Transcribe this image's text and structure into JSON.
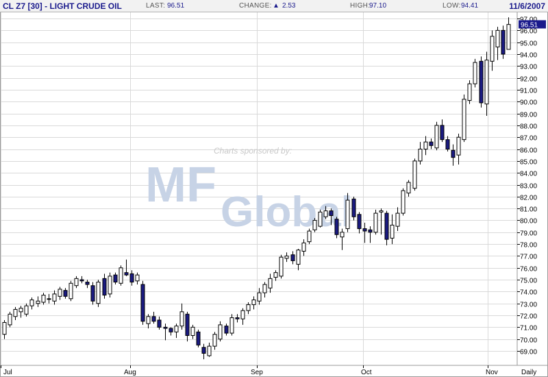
{
  "header": {
    "title": "CL Z7 [30] - LIGHT CRUDE OIL",
    "last_label": "LAST:",
    "last_value": "96.51",
    "change_label": "CHANGE:",
    "change_value": "2.53",
    "high_label": "HIGH:",
    "high_value": "97.10",
    "low_label": "LOW:",
    "low_value": "94.41",
    "date": "11/6/2007"
  },
  "watermark": {
    "sponsor_text": "Charts sponsored by:",
    "logo_text": "MF",
    "logo_word": "Global"
  },
  "period_label": "Daily",
  "last_price_tag": "96.51",
  "colors": {
    "up_fill": "#ffffff",
    "down_fill": "#1a1a80",
    "candle_stroke": "#000000",
    "grid": "#d9d9d9",
    "change_arrow": "#1a1a8c",
    "price_tag_bg": "#1a1a8c"
  },
  "chart_data": {
    "type": "candlestick",
    "y_range": [
      68,
      97
    ],
    "y_ticks": [
      "69.00",
      "70.00",
      "71.00",
      "72.00",
      "73.00",
      "74.00",
      "75.00",
      "76.00",
      "77.00",
      "78.00",
      "79.00",
      "80.00",
      "81.00",
      "82.00",
      "83.00",
      "84.00",
      "85.00",
      "86.00",
      "87.00",
      "88.00",
      "89.00",
      "90.00",
      "91.00",
      "92.00",
      "93.00",
      "94.00",
      "95.00",
      "96.00",
      "97.00"
    ],
    "x_labels": [
      "Jul",
      "Aug",
      "Sep",
      "Oct",
      "Nov"
    ],
    "candles": [
      {
        "o": 70.4,
        "h": 71.6,
        "l": 70.0,
        "c": 71.4
      },
      {
        "o": 71.2,
        "h": 72.3,
        "l": 71.0,
        "c": 72.1
      },
      {
        "o": 71.9,
        "h": 72.7,
        "l": 71.6,
        "c": 72.5
      },
      {
        "o": 72.3,
        "h": 72.8,
        "l": 71.8,
        "c": 72.6
      },
      {
        "o": 72.1,
        "h": 73.0,
        "l": 71.9,
        "c": 72.8
      },
      {
        "o": 72.8,
        "h": 73.5,
        "l": 72.5,
        "c": 73.3
      },
      {
        "o": 73.0,
        "h": 73.6,
        "l": 72.7,
        "c": 73.2
      },
      {
        "o": 73.1,
        "h": 73.9,
        "l": 72.9,
        "c": 73.7
      },
      {
        "o": 73.4,
        "h": 73.8,
        "l": 73.0,
        "c": 73.4
      },
      {
        "o": 73.2,
        "h": 74.1,
        "l": 72.9,
        "c": 73.8
      },
      {
        "o": 73.6,
        "h": 74.4,
        "l": 73.3,
        "c": 74.2
      },
      {
        "o": 74.1,
        "h": 74.3,
        "l": 73.4,
        "c": 73.6
      },
      {
        "o": 73.4,
        "h": 74.9,
        "l": 73.2,
        "c": 74.7
      },
      {
        "o": 74.5,
        "h": 75.3,
        "l": 74.3,
        "c": 75.1
      },
      {
        "o": 75.0,
        "h": 75.3,
        "l": 74.7,
        "c": 74.9
      },
      {
        "o": 74.8,
        "h": 75.0,
        "l": 74.3,
        "c": 74.6
      },
      {
        "o": 74.5,
        "h": 74.8,
        "l": 72.9,
        "c": 73.2
      },
      {
        "o": 73.0,
        "h": 75.0,
        "l": 72.7,
        "c": 74.8
      },
      {
        "o": 75.1,
        "h": 75.5,
        "l": 73.4,
        "c": 73.7
      },
      {
        "o": 73.8,
        "h": 75.6,
        "l": 73.5,
        "c": 75.3
      },
      {
        "o": 75.4,
        "h": 75.6,
        "l": 74.6,
        "c": 74.8
      },
      {
        "o": 74.7,
        "h": 76.2,
        "l": 74.5,
        "c": 76.0
      },
      {
        "o": 75.6,
        "h": 76.7,
        "l": 75.3,
        "c": 75.4
      },
      {
        "o": 75.5,
        "h": 75.8,
        "l": 74.5,
        "c": 74.8
      },
      {
        "o": 74.9,
        "h": 75.6,
        "l": 74.6,
        "c": 75.4
      },
      {
        "o": 74.6,
        "h": 74.9,
        "l": 71.2,
        "c": 71.5
      },
      {
        "o": 71.3,
        "h": 72.1,
        "l": 70.9,
        "c": 71.9
      },
      {
        "o": 71.9,
        "h": 72.3,
        "l": 71.3,
        "c": 71.5
      },
      {
        "o": 71.6,
        "h": 71.9,
        "l": 70.8,
        "c": 71.0
      },
      {
        "o": 71.0,
        "h": 71.3,
        "l": 69.9,
        "c": 70.9
      },
      {
        "o": 70.9,
        "h": 71.0,
        "l": 70.3,
        "c": 70.6
      },
      {
        "o": 70.6,
        "h": 71.3,
        "l": 70.1,
        "c": 71.1
      },
      {
        "o": 71.1,
        "h": 73.0,
        "l": 70.8,
        "c": 72.3
      },
      {
        "o": 72.1,
        "h": 72.3,
        "l": 69.8,
        "c": 70.3
      },
      {
        "o": 70.3,
        "h": 71.2,
        "l": 70.0,
        "c": 71.0
      },
      {
        "o": 70.6,
        "h": 70.8,
        "l": 69.3,
        "c": 69.5
      },
      {
        "o": 69.3,
        "h": 69.6,
        "l": 68.3,
        "c": 68.8
      },
      {
        "o": 68.6,
        "h": 69.7,
        "l": 68.5,
        "c": 69.4
      },
      {
        "o": 69.4,
        "h": 70.6,
        "l": 69.1,
        "c": 70.4
      },
      {
        "o": 70.0,
        "h": 71.5,
        "l": 69.8,
        "c": 71.2
      },
      {
        "o": 71.1,
        "h": 71.3,
        "l": 70.3,
        "c": 70.5
      },
      {
        "o": 70.5,
        "h": 72.1,
        "l": 70.3,
        "c": 71.8
      },
      {
        "o": 71.8,
        "h": 72.1,
        "l": 71.4,
        "c": 71.7
      },
      {
        "o": 71.7,
        "h": 72.6,
        "l": 71.2,
        "c": 72.4
      },
      {
        "o": 72.4,
        "h": 73.1,
        "l": 72.1,
        "c": 72.9
      },
      {
        "o": 72.9,
        "h": 73.6,
        "l": 72.5,
        "c": 73.3
      },
      {
        "o": 73.2,
        "h": 74.3,
        "l": 72.9,
        "c": 73.9
      },
      {
        "o": 73.9,
        "h": 74.8,
        "l": 73.5,
        "c": 74.6
      },
      {
        "o": 74.3,
        "h": 75.5,
        "l": 73.9,
        "c": 75.1
      },
      {
        "o": 75.2,
        "h": 75.8,
        "l": 74.9,
        "c": 75.6
      },
      {
        "o": 75.3,
        "h": 77.1,
        "l": 75.1,
        "c": 76.9
      },
      {
        "o": 76.8,
        "h": 77.3,
        "l": 76.5,
        "c": 77.0
      },
      {
        "o": 77.1,
        "h": 77.4,
        "l": 76.3,
        "c": 76.6
      },
      {
        "o": 76.3,
        "h": 77.6,
        "l": 75.8,
        "c": 77.5
      },
      {
        "o": 77.4,
        "h": 78.4,
        "l": 77.0,
        "c": 78.1
      },
      {
        "o": 78.2,
        "h": 79.3,
        "l": 78.0,
        "c": 79.1
      },
      {
        "o": 79.2,
        "h": 80.2,
        "l": 79.0,
        "c": 80.0
      },
      {
        "o": 79.5,
        "h": 80.9,
        "l": 79.4,
        "c": 80.7
      },
      {
        "o": 80.3,
        "h": 81.2,
        "l": 80.1,
        "c": 80.8
      },
      {
        "o": 80.8,
        "h": 81.0,
        "l": 79.6,
        "c": 80.4
      },
      {
        "o": 80.1,
        "h": 80.3,
        "l": 78.5,
        "c": 78.8
      },
      {
        "o": 78.6,
        "h": 79.3,
        "l": 77.5,
        "c": 79.0
      },
      {
        "o": 79.3,
        "h": 82.3,
        "l": 79.0,
        "c": 81.7
      },
      {
        "o": 81.8,
        "h": 82.0,
        "l": 80.0,
        "c": 80.3
      },
      {
        "o": 80.5,
        "h": 80.7,
        "l": 78.9,
        "c": 79.3
      },
      {
        "o": 79.3,
        "h": 79.8,
        "l": 78.1,
        "c": 79.1
      },
      {
        "o": 79.2,
        "h": 79.5,
        "l": 78.1,
        "c": 79.0
      },
      {
        "o": 79.0,
        "h": 80.9,
        "l": 78.8,
        "c": 80.6
      },
      {
        "o": 80.7,
        "h": 81.0,
        "l": 78.8,
        "c": 80.8
      },
      {
        "o": 80.6,
        "h": 80.8,
        "l": 77.9,
        "c": 78.4
      },
      {
        "o": 78.5,
        "h": 80.5,
        "l": 78.0,
        "c": 79.6
      },
      {
        "o": 79.5,
        "h": 81.1,
        "l": 79.1,
        "c": 80.6
      },
      {
        "o": 80.6,
        "h": 82.7,
        "l": 80.4,
        "c": 82.5
      },
      {
        "o": 82.3,
        "h": 83.4,
        "l": 82.0,
        "c": 83.2
      },
      {
        "o": 82.7,
        "h": 85.2,
        "l": 82.5,
        "c": 85.0
      },
      {
        "o": 85.0,
        "h": 86.6,
        "l": 84.7,
        "c": 86.0
      },
      {
        "o": 86.0,
        "h": 87.1,
        "l": 85.5,
        "c": 86.6
      },
      {
        "o": 86.6,
        "h": 86.9,
        "l": 86.0,
        "c": 86.3
      },
      {
        "o": 86.1,
        "h": 88.3,
        "l": 85.9,
        "c": 88.0
      },
      {
        "o": 88.0,
        "h": 88.5,
        "l": 86.6,
        "c": 86.8
      },
      {
        "o": 86.8,
        "h": 87.1,
        "l": 85.8,
        "c": 86.0
      },
      {
        "o": 85.9,
        "h": 86.4,
        "l": 84.6,
        "c": 85.3
      },
      {
        "o": 85.5,
        "h": 87.3,
        "l": 84.7,
        "c": 87.0
      },
      {
        "o": 86.8,
        "h": 90.6,
        "l": 86.6,
        "c": 90.2
      },
      {
        "o": 90.1,
        "h": 91.8,
        "l": 89.8,
        "c": 91.5
      },
      {
        "o": 91.5,
        "h": 93.6,
        "l": 91.2,
        "c": 93.3
      },
      {
        "o": 93.4,
        "h": 93.8,
        "l": 89.5,
        "c": 89.9
      },
      {
        "o": 89.8,
        "h": 94.2,
        "l": 88.8,
        "c": 93.5
      },
      {
        "o": 93.4,
        "h": 96.0,
        "l": 92.6,
        "c": 95.5
      },
      {
        "o": 94.6,
        "h": 96.3,
        "l": 93.5,
        "c": 96.0
      },
      {
        "o": 96.0,
        "h": 96.4,
        "l": 93.6,
        "c": 94.0
      },
      {
        "o": 94.4,
        "h": 97.1,
        "l": 94.4,
        "c": 96.5
      }
    ]
  }
}
